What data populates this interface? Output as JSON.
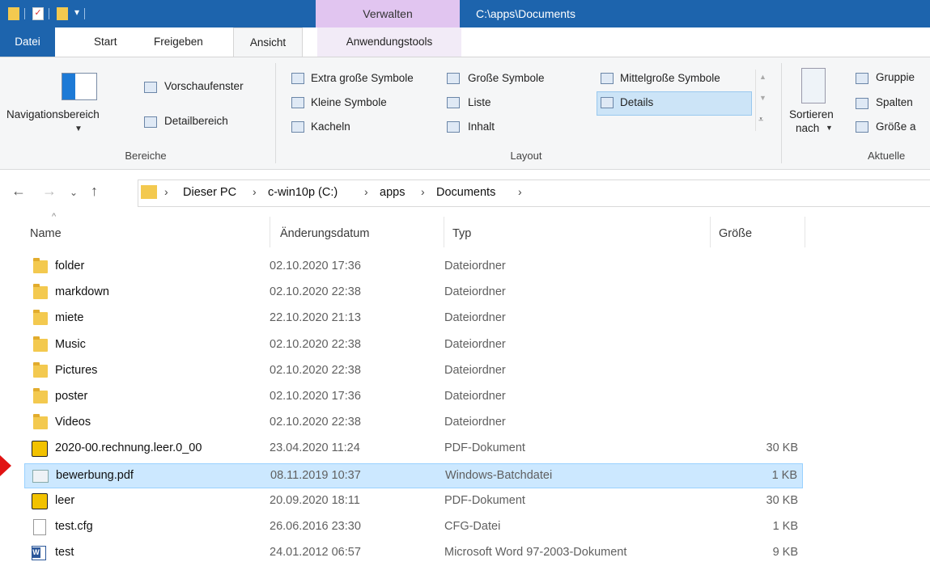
{
  "titlebar": {
    "context_tab": "Verwalten",
    "path": "C:\\apps\\Documents"
  },
  "ribbon_tabs": [
    "Datei",
    "Start",
    "Freigeben",
    "Ansicht",
    "Anwendungstools"
  ],
  "ribbon": {
    "bereiche": {
      "nav_pane_label": "Navigationsbereich",
      "preview_pane": "Vorschaufenster",
      "details_pane": "Detailbereich",
      "group_label": "Bereiche"
    },
    "layout": {
      "options": [
        "Extra große Symbole",
        "Große Symbole",
        "Mittelgroße Symbole",
        "Kleine Symbole",
        "Liste",
        "Details",
        "Kacheln",
        "Inhalt"
      ],
      "selected": "Details",
      "group_label": "Layout"
    },
    "aktuelle": {
      "sort_label_1": "Sortieren",
      "sort_label_2": "nach",
      "group_by": "Gruppie",
      "add_columns": "Spalten",
      "size_all": "Größe a",
      "group_label": "Aktuelle"
    }
  },
  "address": {
    "crumbs": [
      "Dieser PC",
      "c-win10p (C:)",
      "apps",
      "Documents"
    ]
  },
  "columns": {
    "name": "Name",
    "date": "Änderungsdatum",
    "type": "Typ",
    "size": "Größe"
  },
  "files": [
    {
      "name": "folder",
      "date": "02.10.2020 17:36",
      "type": "Dateiordner",
      "size": "",
      "icon": "folder-icon"
    },
    {
      "name": "markdown",
      "date": "02.10.2020 22:38",
      "type": "Dateiordner",
      "size": "",
      "icon": "folder-icon"
    },
    {
      "name": "miete",
      "date": "22.10.2020 21:13",
      "type": "Dateiordner",
      "size": "",
      "icon": "folder-icon"
    },
    {
      "name": "Music",
      "date": "02.10.2020 22:38",
      "type": "Dateiordner",
      "size": "",
      "icon": "folder-icon"
    },
    {
      "name": "Pictures",
      "date": "02.10.2020 22:38",
      "type": "Dateiordner",
      "size": "",
      "icon": "folder-icon"
    },
    {
      "name": "poster",
      "date": "02.10.2020 17:36",
      "type": "Dateiordner",
      "size": "",
      "icon": "folder-icon"
    },
    {
      "name": "Videos",
      "date": "02.10.2020 22:38",
      "type": "Dateiordner",
      "size": "",
      "icon": "folder-icon"
    },
    {
      "name": "2020-00.rechnung.leer.0_00",
      "date": "23.04.2020 11:24",
      "type": "PDF-Dokument",
      "size": "30 KB",
      "icon": "pdf-icon"
    },
    {
      "name": "bewerbung.pdf",
      "date": "08.11.2019 10:37",
      "type": "Windows-Batchdatei",
      "size": "1 KB",
      "icon": "batch-file-icon",
      "selected": true
    },
    {
      "name": "leer",
      "date": "20.09.2020 18:11",
      "type": "PDF-Dokument",
      "size": "30 KB",
      "icon": "pdf-icon"
    },
    {
      "name": "test.cfg",
      "date": "26.06.2016 23:30",
      "type": "CFG-Datei",
      "size": "1 KB",
      "icon": "document-icon"
    },
    {
      "name": "test",
      "date": "24.01.2012 06:57",
      "type": "Microsoft Word 97-2003-Dokument",
      "size": "9 KB",
      "icon": "word-document-icon"
    }
  ],
  "colors": {
    "titlebar": "#1d64ad",
    "context_tab": "#e1c5f0",
    "selection": "#cce8ff",
    "pointer": "#e11313"
  }
}
